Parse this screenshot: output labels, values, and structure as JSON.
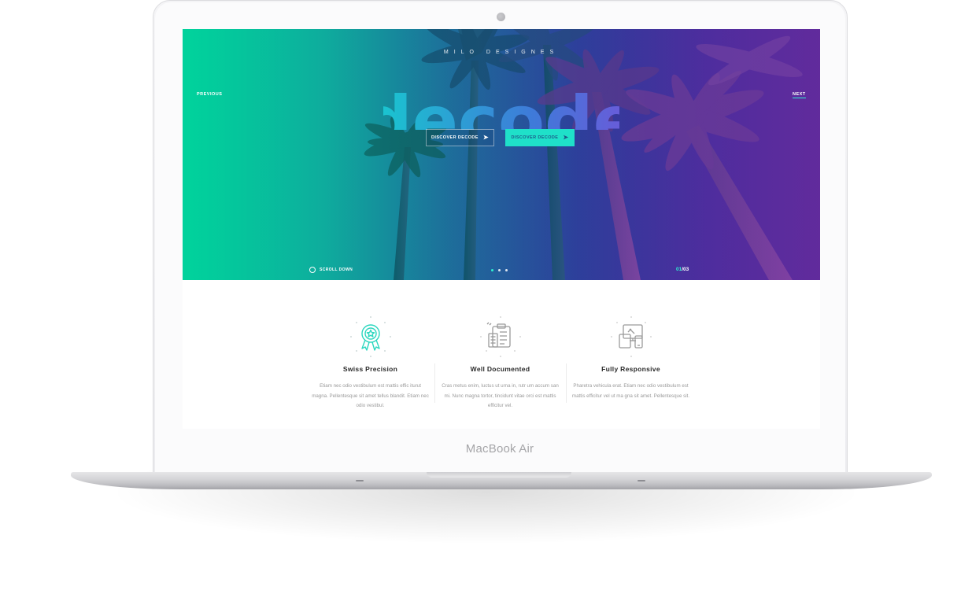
{
  "device": {
    "brand_label": "MacBook Air"
  },
  "hero": {
    "kicker": "MILO DESIGNES",
    "logo_text": "decode",
    "nav_previous": "PREVIOUS",
    "nav_next": "NEXT",
    "button_outline_label": "DISCOVER DECODE",
    "button_solid_label": "DISCOVER DECODE",
    "scroll_label": "SCROLL DOWN",
    "slide_current": "01",
    "slide_separator": "/",
    "slide_total": "03",
    "colors": {
      "accent": "#2ef0d0",
      "gradient_start": "#00d39c",
      "gradient_end": "#5d2c98"
    }
  },
  "features": [
    {
      "icon": "award-ribbon-icon",
      "title": "Swiss Precision",
      "text": "Etiam nec odio vestibulum est mattis effic iturut magna. Pellentesque sit amet tellus blandit. Etiam nec odio vestibul."
    },
    {
      "icon": "clipboard-document-icon",
      "title": "Well Documented",
      "text": "Cras metus enim, luctus ut urna in, rutr um accum san mi. Nunc magna tortor, tincidunt vitae orci est mattis efficitur vel."
    },
    {
      "icon": "responsive-devices-icon",
      "title": "Fully Responsive",
      "text": "Pharetra vehicula erat. Etiam nec odio vestibulum est mattis efficitur vel ut ma gna sit amet. Pellentesque sit."
    }
  ]
}
